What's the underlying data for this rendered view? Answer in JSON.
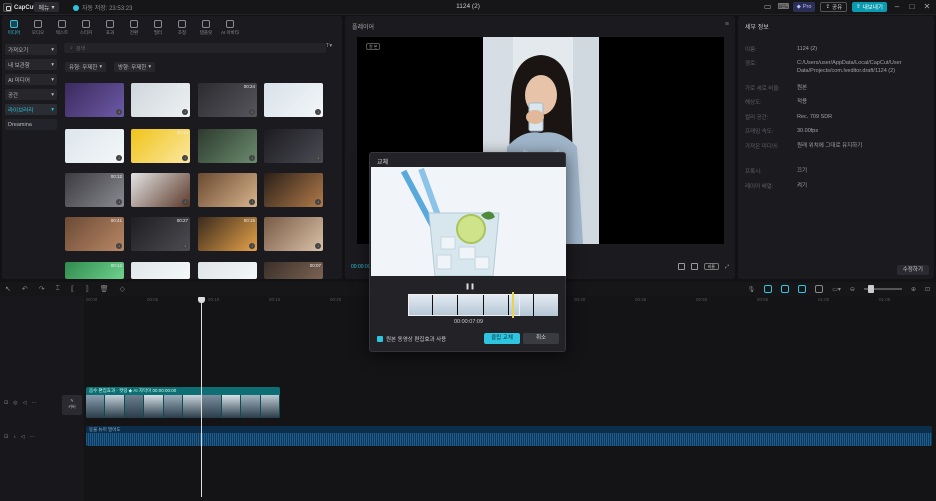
{
  "app": {
    "name": "CapCut",
    "menu_label": "메뉴",
    "autosave": "자동 저장: 23:53:23",
    "project_title": "1124 (2)"
  },
  "topbar": {
    "pro_label": "Pro",
    "share_label": "공유",
    "export_label": "내보내기"
  },
  "toolbar": {
    "tabs": [
      {
        "label": "미디어",
        "icon": "media-icon"
      },
      {
        "label": "오디오",
        "icon": "audio-icon"
      },
      {
        "label": "텍스트",
        "icon": "text-icon"
      },
      {
        "label": "스티커",
        "icon": "sticker-icon"
      },
      {
        "label": "효과",
        "icon": "effect-icon"
      },
      {
        "label": "전환",
        "icon": "transition-icon"
      },
      {
        "label": "필터",
        "icon": "filter-icon"
      },
      {
        "label": "조정",
        "icon": "adjust-icon"
      },
      {
        "label": "템플릿",
        "icon": "template-icon"
      },
      {
        "label": "AI 아바타",
        "icon": "ai-avatar-icon"
      }
    ]
  },
  "categories": [
    {
      "label": "가져오기",
      "active": false
    },
    {
      "label": "내 보관함",
      "active": false
    },
    {
      "label": "AI 미디어",
      "active": false
    },
    {
      "label": "공간",
      "active": false
    },
    {
      "label": "라이브러리",
      "active": true
    },
    {
      "label": "Dreamina",
      "active": false
    }
  ],
  "search": {
    "placeholder": "검색"
  },
  "filters": {
    "first": "유형: 무제한",
    "second": "방향: 무제한"
  },
  "media": {
    "durations": [
      "",
      "00:09",
      "00:24",
      "",
      "",
      "00:16",
      "",
      "",
      "00:12",
      "",
      "",
      "",
      "00:41",
      "00:27",
      "00:15",
      "",
      "00:12",
      "00:12",
      "",
      "00:07"
    ]
  },
  "player": {
    "title": "플레이어",
    "timecode": "00:00:00:00",
    "badge": "원 본",
    "ratio_label": "비율"
  },
  "detail": {
    "title": "세부 정보",
    "rows": [
      {
        "label": "이름:",
        "value": "1124 (2)"
      },
      {
        "label": "경로:",
        "value": "C:/Users/user/AppData/Local/CapCut/User Data/Projects/com.lveditor.draft/1124 (2)"
      },
      {
        "label": "가로 세로 비율:",
        "value": "원본"
      },
      {
        "label": "해상도:",
        "value": "적용"
      },
      {
        "label": "컬러 공간:",
        "value": "Rec. 709 SDR"
      },
      {
        "label": "프레임 속도:",
        "value": "30.00fps"
      },
      {
        "label": "가져온 미디어:",
        "value": "원래 위치에 그대로 유지하기"
      },
      {
        "label": "프록시:",
        "value": "끄기"
      },
      {
        "label": "레이어 배열:",
        "value": "켜기"
      }
    ],
    "modify_label": "수정하기"
  },
  "timeline": {
    "ruler": [
      "00:00",
      "00:05",
      "00:10",
      "00:15",
      "00:20",
      "00:25",
      "00:30",
      "00:35",
      "00:40",
      "00:45",
      "00:50",
      "00:55",
      "01:00",
      "01:05"
    ],
    "cover_label": "커버",
    "clip_label": "음수 편집효과 · 컷링  ◆ AI 자막이  00:00:00:00",
    "audio_label": "동물 뉴미 멀어도"
  },
  "dialog": {
    "title": "교체",
    "timecode": "00:00:07:09",
    "checkbox_label": "원본 동영상 편집효과 사용",
    "ok_label": "클립 교체",
    "cancel_label": "취소",
    "pause_icon": "pause-icon"
  }
}
